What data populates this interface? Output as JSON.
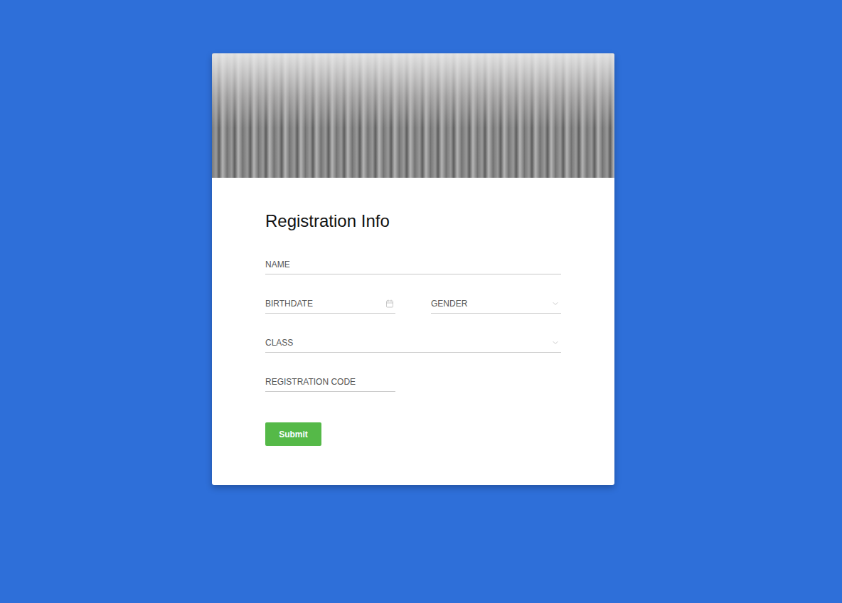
{
  "form": {
    "title": "Registration Info",
    "fields": [
      {
        "label": "NAME",
        "kind": "text"
      },
      {
        "label": "BIRTHDATE",
        "kind": "date"
      },
      {
        "label": "GENDER",
        "kind": "select"
      },
      {
        "label": "CLASS",
        "kind": "select"
      },
      {
        "label": "REGISTRATION CODE",
        "kind": "text"
      }
    ],
    "submit": "Submit"
  }
}
